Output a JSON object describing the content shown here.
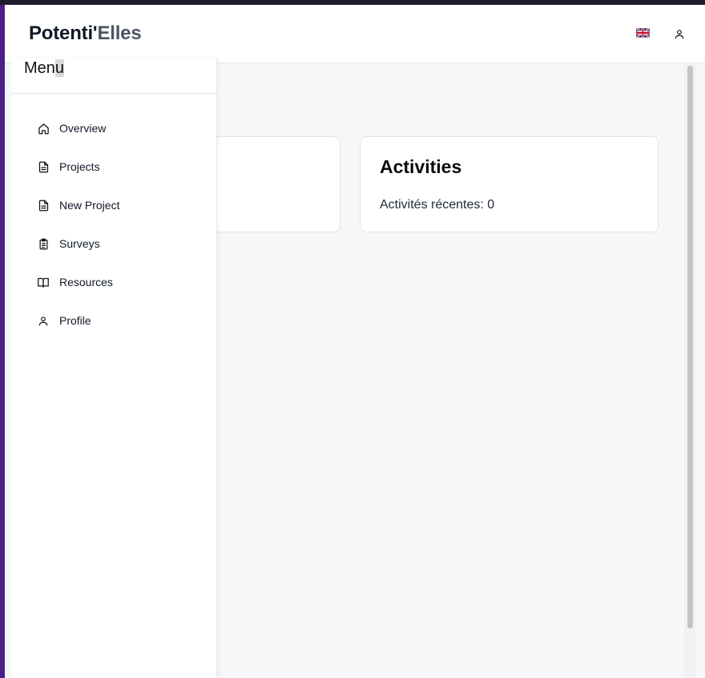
{
  "header": {
    "brand_part1": "Potenti'",
    "brand_part2": "Elles",
    "language_icon": "uk-flag-icon",
    "user_icon": "user-icon"
  },
  "sidebar": {
    "title_main": "Men",
    "title_cursor": "u",
    "items": [
      {
        "label": "Overview",
        "icon": "home-icon"
      },
      {
        "label": "Projects",
        "icon": "document-icon"
      },
      {
        "label": "New Project",
        "icon": "document-icon"
      },
      {
        "label": "Surveys",
        "icon": "clipboard-list-icon"
      },
      {
        "label": "Resources",
        "icon": "book-open-icon"
      },
      {
        "label": "Profile",
        "icon": "user-icon"
      }
    ]
  },
  "cards": {
    "activities": {
      "title": "Activities",
      "text": "Activités récentes: 0"
    }
  },
  "colors": {
    "brand_dark": "#111827",
    "brand_muted": "#4b5563",
    "page_bg": "#f6f7f9"
  }
}
